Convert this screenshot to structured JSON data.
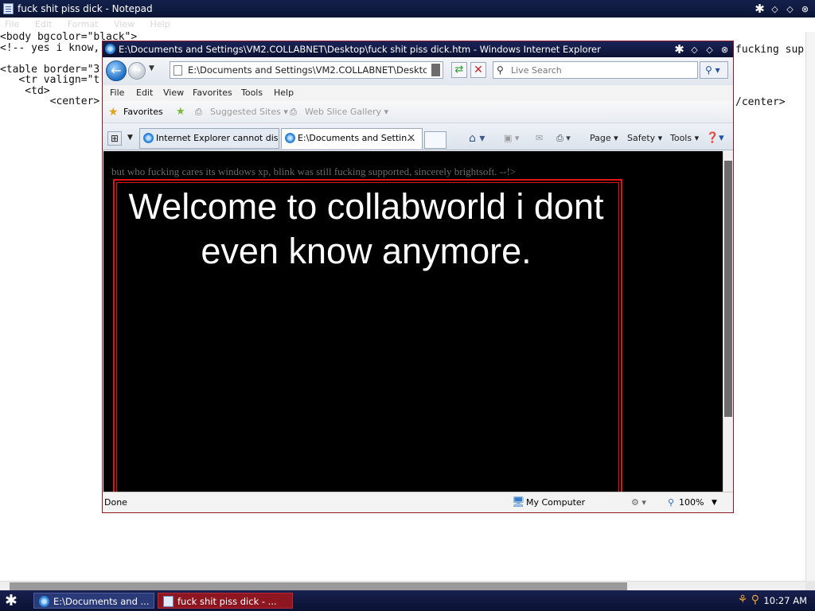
{
  "notepad": {
    "title": "fuck shit piss dick - Notepad",
    "menu": [
      "File",
      "Edit",
      "Format",
      "View",
      "Help"
    ],
    "text_lines": [
      "<body bgcolor=\"black\">",
      "<!-- yes i know,",
      "",
      "<table border=\"3",
      "   <tr valign=\"t",
      "    <td>",
      "        <center>"
    ],
    "right_fragment_1": "fucking sup",
    "right_fragment_2": "/center>"
  },
  "ie": {
    "title": "E:\\Documents and Settings\\VM2.COLLABNET\\Desktop\\fuck shit piss dick.htm - Windows Internet Explorer",
    "address": "E:\\Documents and Settings\\VM2.COLLABNET\\Desktop\\fuck shit",
    "search_placeholder": "Live Search",
    "menu": [
      "File",
      "Edit",
      "View",
      "Favorites",
      "Tools",
      "Help"
    ],
    "favorites": {
      "favorites_label": "Favorites",
      "suggested_sites": "Suggested Sites ▾",
      "web_slice_gallery": "Web Slice Gallery ▾"
    },
    "tabs": [
      {
        "label": "Internet Explorer cannot dis..."
      },
      {
        "label": "E:\\Documents and Settin..."
      }
    ],
    "command_bar": {
      "page": "Page ▾",
      "safety": "Safety ▾",
      "tools": "Tools ▾"
    },
    "page": {
      "comment": "but who fucking cares its windows xp, blink was still fucking supported, sincerely brightsoft. --!>",
      "welcome": "Welcome to collabworld i dont even know anymore."
    },
    "status": {
      "text": "Done",
      "zone": "My Computer",
      "zoom": "100%"
    }
  },
  "taskbar": {
    "items": [
      {
        "label": "E:\\Documents and ..."
      },
      {
        "label": "fuck shit piss dick - ..."
      }
    ],
    "clock": "10:27 AM"
  },
  "colors": {
    "titlebar": "#0d1640",
    "page_bg": "#000000",
    "frame_red": "#e01414",
    "comment_gray": "#6a6a6a"
  }
}
